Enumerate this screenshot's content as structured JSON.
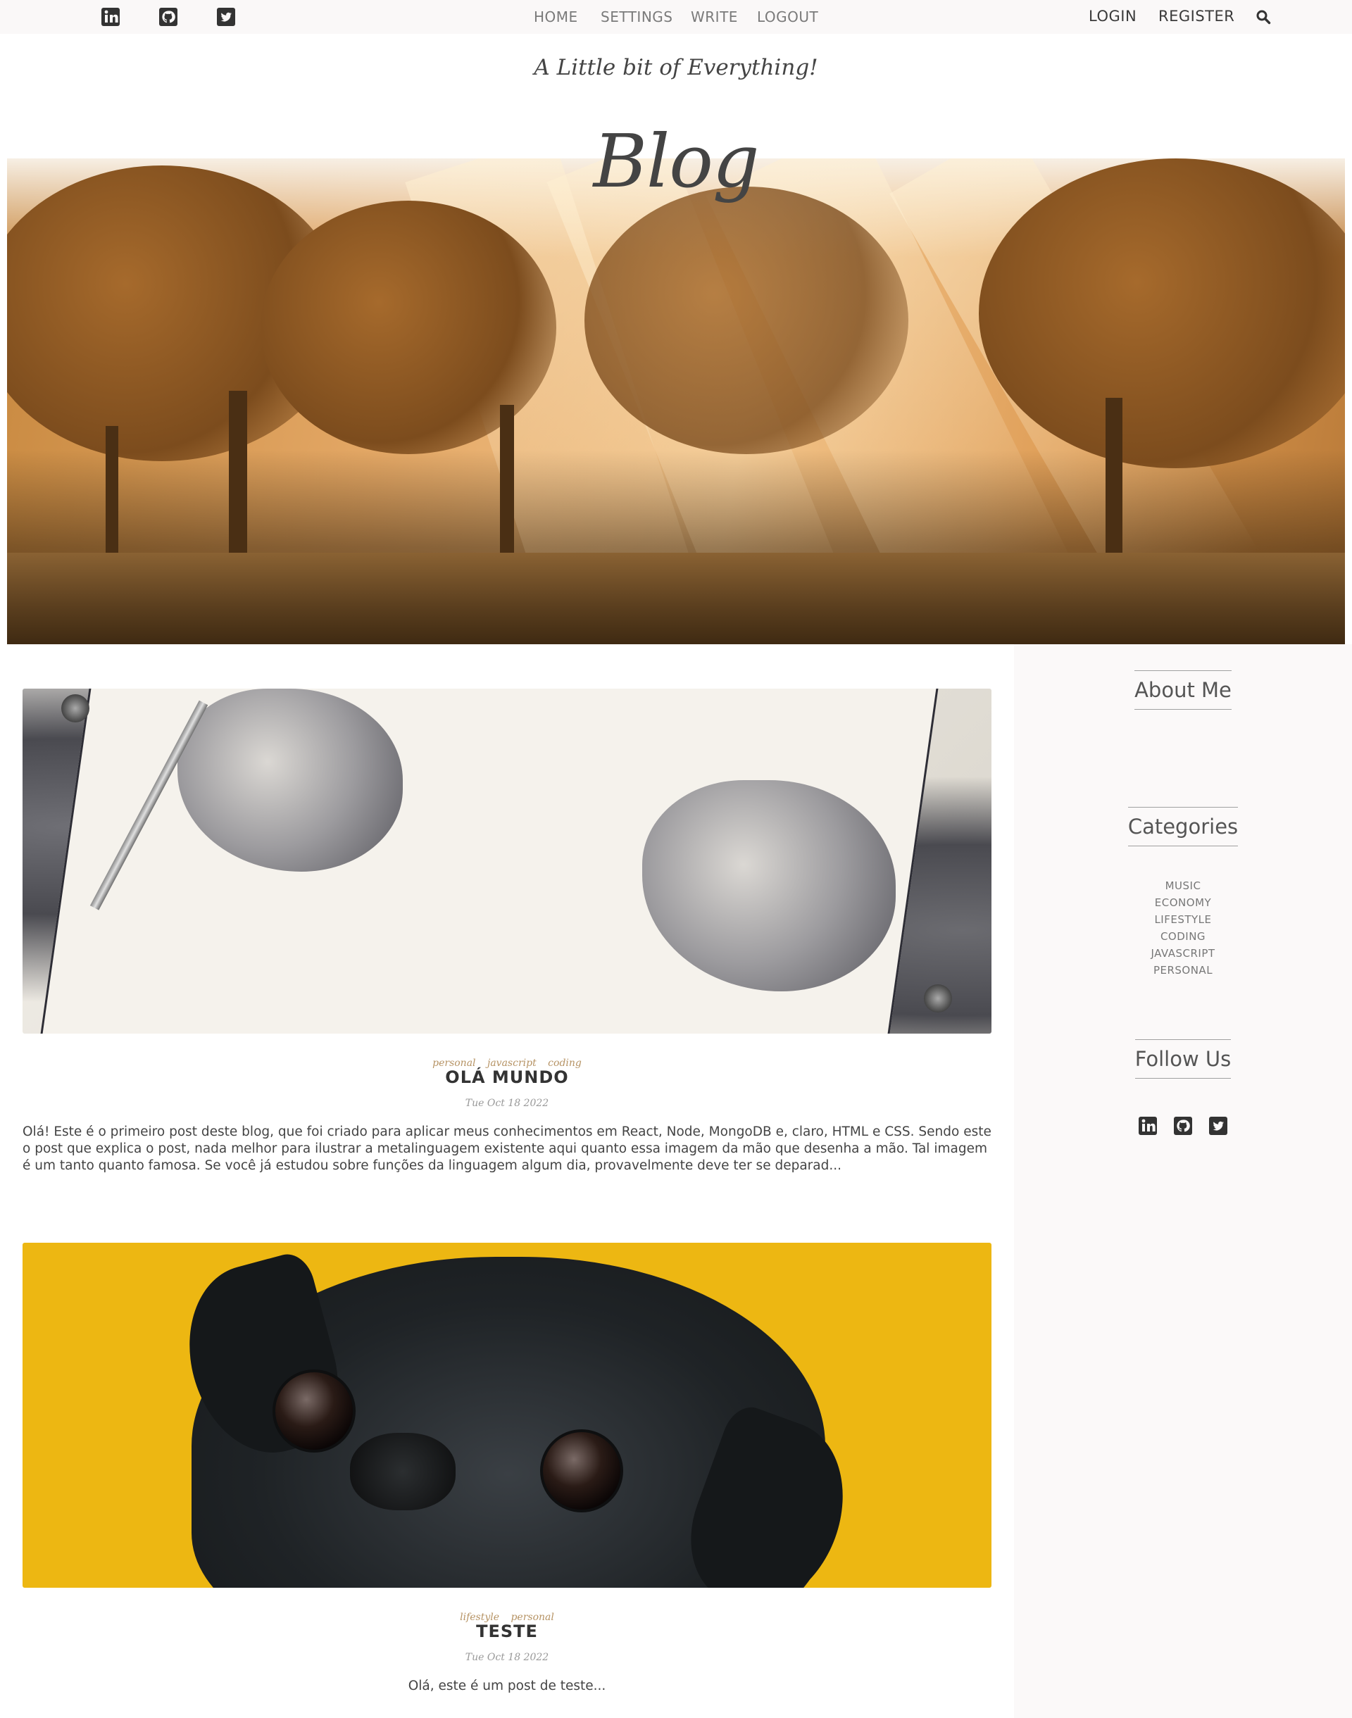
{
  "topbar": {
    "social": [
      {
        "name": "linkedin-icon"
      },
      {
        "name": "github-icon"
      },
      {
        "name": "twitter-icon"
      }
    ],
    "nav": [
      "HOME",
      "SETTINGS",
      "WRITE",
      "LOGOUT"
    ],
    "auth": [
      "LOGIN",
      "REGISTER"
    ],
    "search_icon": "search-icon"
  },
  "header": {
    "subtitle": "A Little bit of Everything!",
    "title": "Blog"
  },
  "posts": [
    {
      "categories": [
        "personal",
        "javascript",
        "coding"
      ],
      "title": "OLÁ MUNDO",
      "date": "Tue Oct 18 2022",
      "excerpt": "Olá! Este é o primeiro post deste blog, que foi criado para aplicar meus conhecimentos em React, Node, MongoDB e, claro, HTML e CSS. Sendo este o post que explica o post, nada melhor para ilustrar a metalinguagem existente aqui quanto essa imagem da mão que desenha a mão. Tal imagem é um tanto quanto famosa. Se você já estudou sobre funções da linguagem algum dia, provavelmente deve ter se deparad..."
    },
    {
      "categories": [
        "lifestyle",
        "personal"
      ],
      "title": "TESTE",
      "date": "Tue Oct 18 2022",
      "excerpt": "Olá, este é um post de teste..."
    }
  ],
  "sidebar": {
    "about_title": "About Me",
    "categories_title": "Categories",
    "categories": [
      "MUSIC",
      "ECONOMY",
      "LIFESTYLE",
      "CODING",
      "JAVASCRIPT",
      "PERSONAL"
    ],
    "follow_title": "Follow Us"
  },
  "colors": {
    "tag": "#b69364",
    "text": "#444444",
    "topbar_bg": "#faf8f8",
    "sidebar_bg": "#fbf9f9",
    "pug_background": "#edb712"
  }
}
